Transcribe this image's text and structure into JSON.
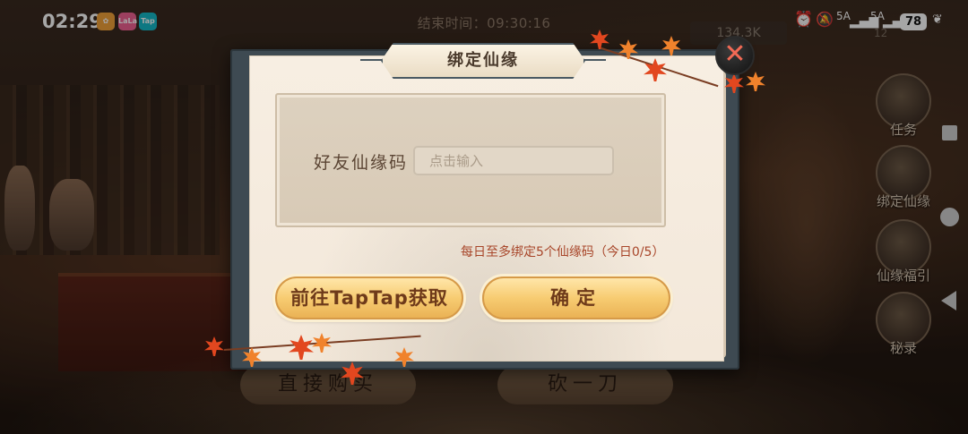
{
  "status_bar": {
    "time": "02:29",
    "app_icons": [
      "gift-app-icon",
      "lala-app-icon",
      "taptap-app-icon"
    ],
    "app_icon_labels": {
      "lala": "LaLa",
      "taptap": "Tap"
    },
    "network_1": "5A",
    "network_2": "5A",
    "battery": "78"
  },
  "background": {
    "timer_text": "结束时间：09:30:16",
    "currency": "134.3K",
    "level": "12",
    "buttons": [
      "直接购买",
      "砍一刀"
    ]
  },
  "side_menu": [
    {
      "label": "任务",
      "icon": "scroll-icon"
    },
    {
      "label": "绑定仙缘",
      "icon": "binding-scroll-icon"
    },
    {
      "label": "仙缘福引",
      "icon": "fortune-scroll-icon"
    },
    {
      "label": "秘录",
      "icon": "secret-book-icon"
    }
  ],
  "dialog": {
    "title": "绑定仙缘",
    "field_label": "好友仙缘码",
    "input_placeholder": "点击输入",
    "input_value": "",
    "daily_limit": "每日至多绑定5个仙缘码（今日0/5）",
    "taptap_button": "前往TapTap获取",
    "confirm_button": "确定",
    "close_symbol": "✕"
  },
  "colors": {
    "accent_gold": "#f7cc72",
    "button_text": "#6e3a1a",
    "limit_text": "#a8462a",
    "close_x": "#f36a55"
  }
}
